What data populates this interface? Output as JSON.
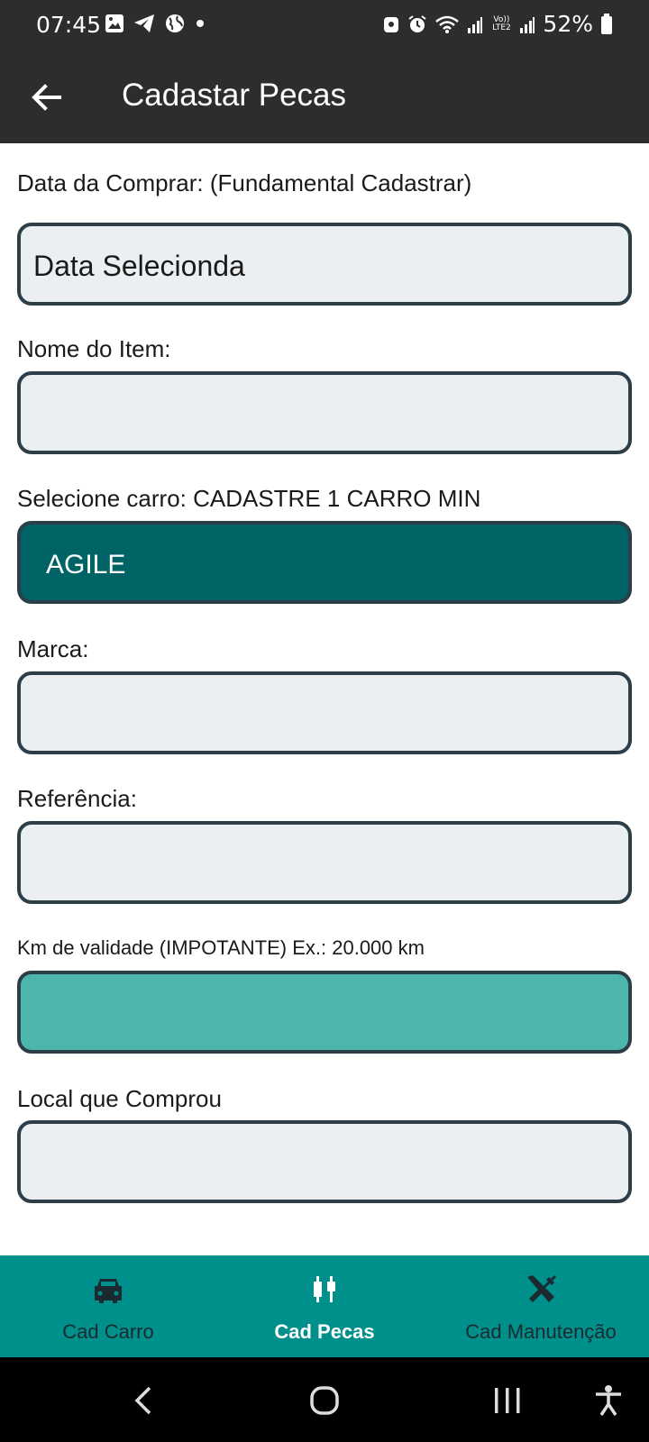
{
  "status_bar": {
    "time": "07:45",
    "battery": "52%",
    "icons_left": [
      "image-icon",
      "telegram-icon",
      "globe-icon",
      "dot-icon"
    ],
    "icons_right": [
      "accessibility-notification-icon",
      "alarm-icon",
      "wifi-icon",
      "signal-icon",
      "volte-icon",
      "signal-icon",
      "battery-icon"
    ],
    "volte_label": "Vo)) LTE2"
  },
  "app_bar": {
    "title": "Cadastar Pecas"
  },
  "form": {
    "purchase_date": {
      "label": "Data da Comprar: (Fundamental Cadastrar)",
      "value": "Data Selecionda"
    },
    "item_name": {
      "label": "Nome do Item:",
      "value": ""
    },
    "car_select": {
      "label": "Selecione carro: CADASTRE 1 CARRO MIN",
      "value": "AGILE"
    },
    "brand": {
      "label": "Marca:",
      "value": ""
    },
    "reference": {
      "label": "Referência:",
      "value": ""
    },
    "validity_km": {
      "label": "Km de validade (IMPOTANTE) Ex.: 20.000 km",
      "value": ""
    },
    "purchase_place": {
      "label": "Local que Comprou",
      "value": ""
    }
  },
  "bottom_nav": {
    "items": [
      {
        "label": "Cad Carro",
        "icon": "car-icon",
        "active": false
      },
      {
        "label": "Cad Pecas",
        "icon": "parts-icon",
        "active": true
      },
      {
        "label": "Cad Manutenção",
        "icon": "tools-icon",
        "active": false
      }
    ]
  },
  "colors": {
    "app_bar": "#2d2d2d",
    "car_select_bg": "#006466",
    "validity_bg": "#4db6ac",
    "bottom_nav_bg": "#00908c",
    "field_bg": "#eceff1"
  }
}
